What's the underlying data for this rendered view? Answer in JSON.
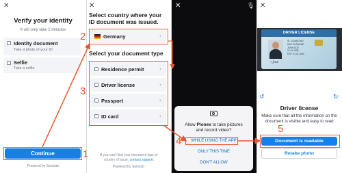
{
  "screen1": {
    "title": "Verify your identity",
    "subtitle": "It will only take 2 minutes",
    "options": [
      {
        "label": "Identity document",
        "desc": "Take a photo of your ID"
      },
      {
        "label": "Selfie",
        "desc": "Take a selfie"
      }
    ],
    "continue_label": "Continue",
    "powered_by": "Powered by Sumsub"
  },
  "screen2": {
    "title_line1": "Select country where your",
    "title_line2": "ID document was issued.",
    "country": "Germany",
    "doc_type_title": "Select your document type",
    "doc_types": [
      "Residence permit",
      "Driver license",
      "Passport",
      "ID card"
    ],
    "help_text_a": "If you can't find your document type or",
    "help_text_b": "country of issue,",
    "help_link": "contact support",
    "powered_by": "Powered by Sumsub"
  },
  "screen3": {
    "dialog_pre": "Allow ",
    "dialog_app": "Pionex",
    "dialog_post": " to take pictures",
    "dialog_line2": "and record video?",
    "buttons": [
      "WHILE USING THE APP",
      "ONLY THIS TIME",
      "DON'T ALLOW"
    ]
  },
  "screen4": {
    "card_header": "DRIVER LICENSE",
    "card_lines": [
      "ID: 1234567890",
      "MAX SURNAME",
      "JOHN DOE",
      "01.01.1990",
      "EXP: 01.01.2030"
    ],
    "title": "Driver license",
    "instructions": "Make sure that all the information on the document is visible and easy to read",
    "readable_label": "Document is readable",
    "retake_label": "Retake photo"
  },
  "annotations": [
    "1",
    "2",
    "3",
    "4",
    "5"
  ],
  "colors": {
    "accent": "#1580e8",
    "annotation": "#e8572e",
    "card_bg": "#f2f4f7"
  }
}
